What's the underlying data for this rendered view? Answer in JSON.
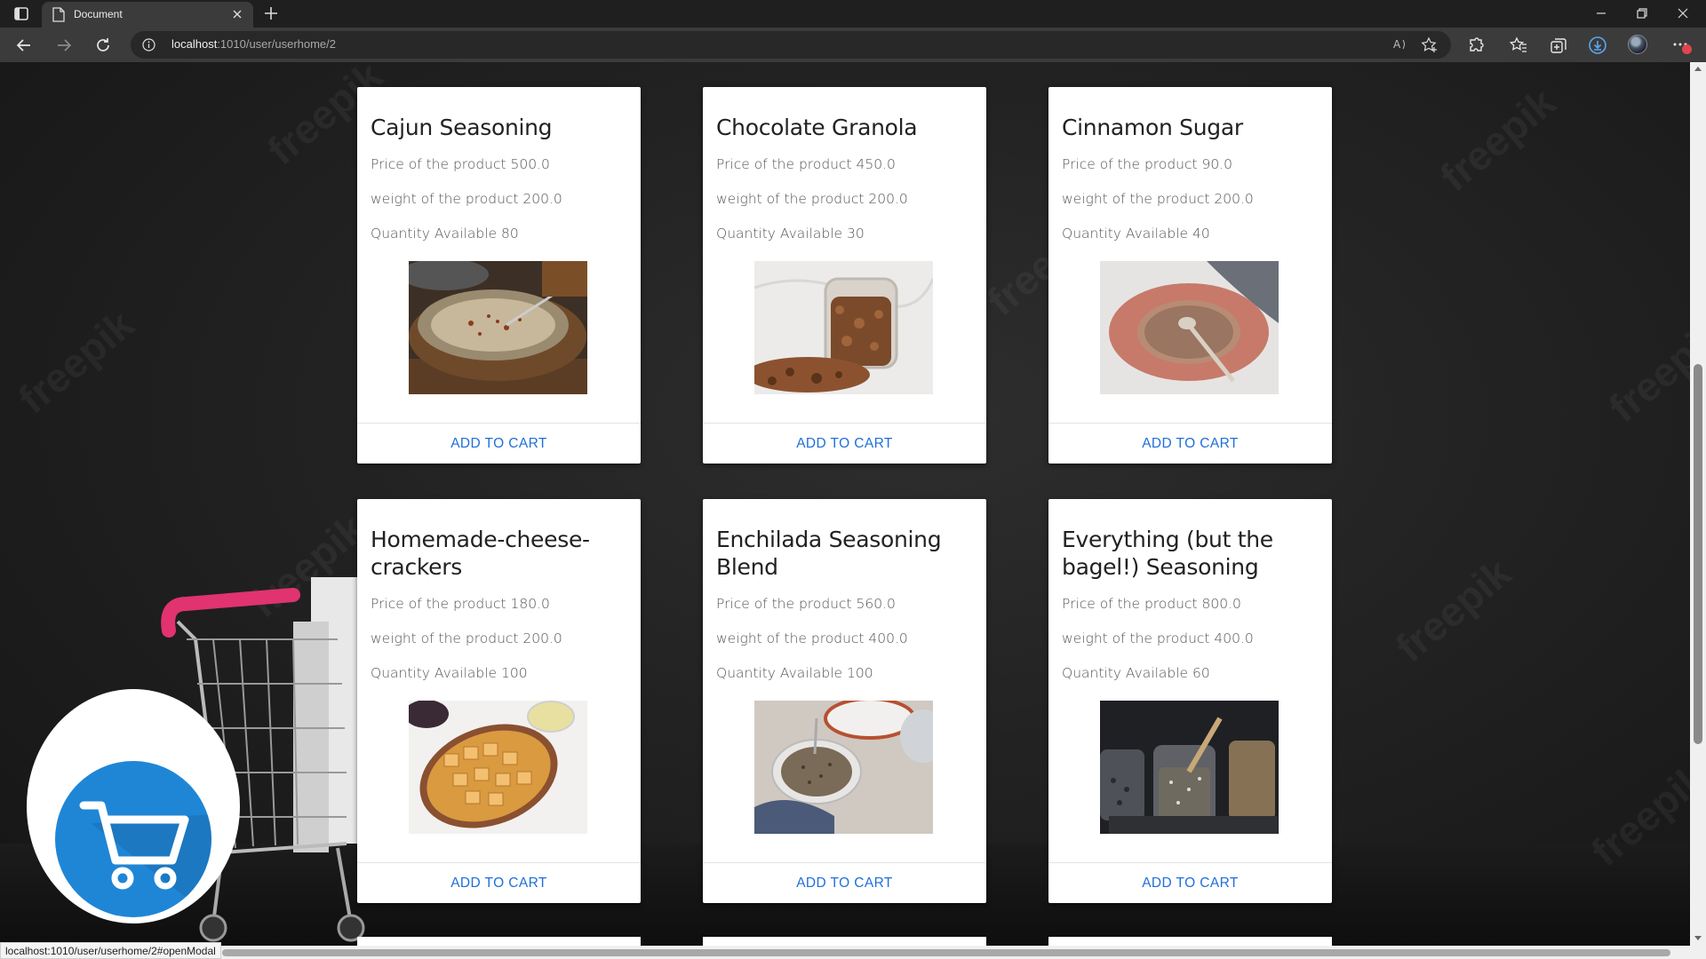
{
  "browser": {
    "tab_title": "Document",
    "url_host": "localhost",
    "url_rest": ":1010/user/userhome/2",
    "status_url": "localhost:1010/user/userhome/2#openModal"
  },
  "watermark_text": "freepik",
  "products": [
    {
      "name": "Cajun Seasoning",
      "price": "Price of the product 500.0",
      "weight": "weight of the product 200.0",
      "quantity": "Quantity Available 80",
      "cta": "ADD TO CART",
      "image": "cajun-seasoning-image"
    },
    {
      "name": "Chocolate Granola",
      "price": "Price of the product 450.0",
      "weight": "weight of the product 200.0",
      "quantity": "Quantity Available 30",
      "cta": "ADD TO CART",
      "image": "chocolate-granola-image"
    },
    {
      "name": "Cinnamon Sugar",
      "price": "Price of the product 90.0",
      "weight": "weight of the product 200.0",
      "quantity": "Quantity Available 40",
      "cta": "ADD TO CART",
      "image": "cinnamon-sugar-image"
    },
    {
      "name": "Homemade-cheese-crackers",
      "price": "Price of the product 180.0",
      "weight": "weight of the product 200.0",
      "quantity": "Quantity Available 100",
      "cta": "ADD TO CART",
      "image": "cheese-crackers-image"
    },
    {
      "name": "Enchilada Seasoning Blend",
      "price": "Price of the product 560.0",
      "weight": "weight of the product 400.0",
      "quantity": "Quantity Available 100",
      "cta": "ADD TO CART",
      "image": "enchilada-seasoning-image"
    },
    {
      "name": "Everything (but the bagel!) Seasoning",
      "price": "Price of the product 800.0",
      "weight": "weight of the product 400.0",
      "quantity": "Quantity Available 60",
      "cta": "ADD TO CART",
      "image": "everything-seasoning-image"
    }
  ],
  "icons": {
    "floating_button": "shopping-cart-icon",
    "address_info": "info-icon",
    "download": "download-icon"
  },
  "colors": {
    "accent": "#1e6fd9",
    "fab_blue": "#1f86d6",
    "cart_handle": "#e0336f"
  }
}
